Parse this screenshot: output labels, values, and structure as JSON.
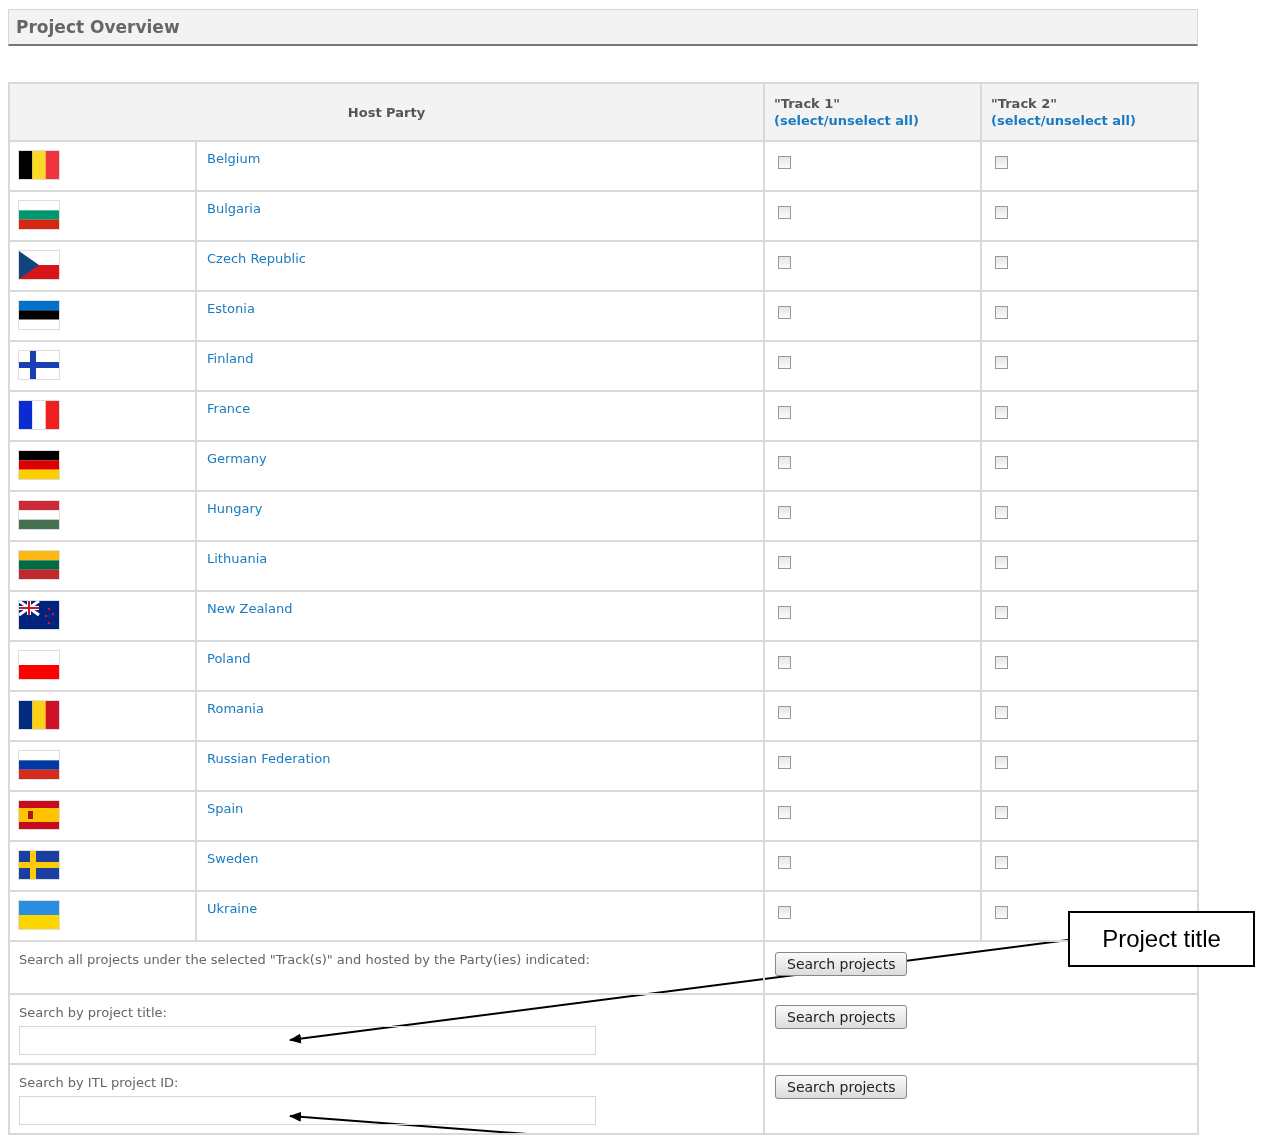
{
  "panel": {
    "title": "Project Overview"
  },
  "table": {
    "columns": {
      "host_party": "Host Party",
      "track_1": {
        "title": "\"Track 1\"",
        "link": "(select/unselect all)"
      },
      "track_2": {
        "title": "\"Track 2\"",
        "link": "(select/unselect all)"
      }
    },
    "rows": [
      {
        "party": "Belgium",
        "track_1_checked": false,
        "track_2_checked": false
      },
      {
        "party": "Bulgaria",
        "track_1_checked": false,
        "track_2_checked": false
      },
      {
        "party": "Czech Republic",
        "track_1_checked": false,
        "track_2_checked": false
      },
      {
        "party": "Estonia",
        "track_1_checked": false,
        "track_2_checked": false
      },
      {
        "party": "Finland",
        "track_1_checked": false,
        "track_2_checked": false
      },
      {
        "party": "France",
        "track_1_checked": false,
        "track_2_checked": false
      },
      {
        "party": "Germany",
        "track_1_checked": false,
        "track_2_checked": false
      },
      {
        "party": "Hungary",
        "track_1_checked": false,
        "track_2_checked": false
      },
      {
        "party": "Lithuania",
        "track_1_checked": false,
        "track_2_checked": false
      },
      {
        "party": "New Zealand",
        "track_1_checked": false,
        "track_2_checked": false
      },
      {
        "party": "Poland",
        "track_1_checked": false,
        "track_2_checked": false
      },
      {
        "party": "Romania",
        "track_1_checked": false,
        "track_2_checked": false
      },
      {
        "party": "Russian Federation",
        "track_1_checked": false,
        "track_2_checked": false
      },
      {
        "party": "Spain",
        "track_1_checked": false,
        "track_2_checked": false
      },
      {
        "party": "Sweden",
        "track_1_checked": false,
        "track_2_checked": false
      },
      {
        "party": "Ukraine",
        "track_1_checked": false,
        "track_2_checked": false
      }
    ]
  },
  "searches": [
    {
      "kind": "text",
      "label": "Search all projects under the selected \"Track(s)\" and hosted by the Party(ies) indicated:",
      "button": "Search projects"
    },
    {
      "kind": "field",
      "label": "Search by project title:",
      "button": "Search projects"
    },
    {
      "kind": "field",
      "label": "Search by ITL project ID:",
      "button": "Search projects"
    }
  ],
  "callout": {
    "text": "Project title"
  }
}
